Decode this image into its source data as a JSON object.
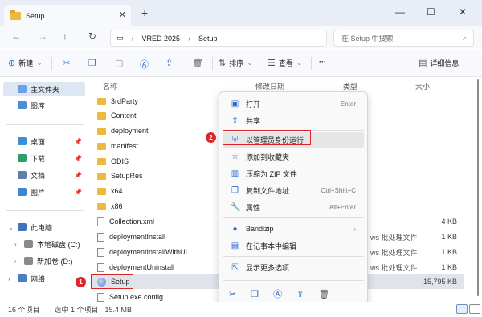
{
  "window": {
    "tab_title": "Setup",
    "close_tab": "✕",
    "new_tab": "+",
    "minimize": "—",
    "maximize": "☐",
    "close": "✕"
  },
  "nav": {
    "back": "←",
    "forward": "→",
    "up": "↑",
    "refresh": "↻"
  },
  "address": {
    "monitor": "▭",
    "sep": "›",
    "crumbs": [
      "VRED 2025",
      "Setup"
    ],
    "chevron": "›",
    "search_placeholder": "在 Setup 中搜索",
    "search_icon": "⌕"
  },
  "toolbar": {
    "new_label": "新建",
    "sort_label": "排序",
    "view_label": "查看",
    "more_label": "···",
    "details_label": "详细信息"
  },
  "sidebar": {
    "home": "主文件夹",
    "gallery": "图库",
    "desktop": "桌面",
    "downloads": "下载",
    "documents": "文档",
    "pictures": "图片",
    "this_pc": "此电脑",
    "local_disk": "本地磁盘 (C:)",
    "new_volume": "新加卷 (D:)",
    "network": "网络"
  },
  "list": {
    "headers": {
      "name": "名称",
      "modified": "修改日期",
      "type": "类型",
      "size": "大小"
    },
    "rows": [
      {
        "name": "3rdParty",
        "kind": "folder",
        "type": "",
        "size": ""
      },
      {
        "name": "Content",
        "kind": "folder",
        "type": "",
        "size": ""
      },
      {
        "name": "deployment",
        "kind": "folder",
        "type": "",
        "size": ""
      },
      {
        "name": "manifest",
        "kind": "folder",
        "type": "",
        "size": ""
      },
      {
        "name": "ODIS",
        "kind": "folder",
        "type": "",
        "size": ""
      },
      {
        "name": "SetupRes",
        "kind": "folder",
        "type": "",
        "size": ""
      },
      {
        "name": "x64",
        "kind": "folder",
        "type": "",
        "size": ""
      },
      {
        "name": "x86",
        "kind": "folder",
        "type": "",
        "size": ""
      },
      {
        "name": "Collection.xml",
        "kind": "xml",
        "type": "",
        "size": "4 KB"
      },
      {
        "name": "deploymentInstall",
        "kind": "bat",
        "type": "ws 批处理文件",
        "size": "1 KB"
      },
      {
        "name": "deploymentInstallWithUI",
        "kind": "bat",
        "type": "ws 批处理文件",
        "size": "1 KB"
      },
      {
        "name": "deploymentUninstall",
        "kind": "bat",
        "type": "ws 批处理文件",
        "size": "1 KB"
      },
      {
        "name": "Setup",
        "kind": "setup",
        "type": "",
        "size": "15,795 KB"
      },
      {
        "name": "Setup.exe.config",
        "kind": "config",
        "type": "",
        "size": ""
      }
    ]
  },
  "context_menu": {
    "open": "打开",
    "open_shortcut": "Enter",
    "share": "共享",
    "run_as_admin": "以管理员身份运行",
    "add_favorites": "添加到收藏夹",
    "compress_zip": "压缩为 ZIP 文件",
    "copy_path": "复制文件地址",
    "copy_path_shortcut": "Ctrl+Shift+C",
    "properties": "属性",
    "properties_shortcut": "Alt+Enter",
    "bandizip": "Bandizip",
    "edit_notepad": "在记事本中编辑",
    "more_options": "显示更多选项"
  },
  "callouts": {
    "one": "1",
    "two": "2"
  },
  "status": {
    "count": "16 个项目",
    "selected": "选中 1 个项目",
    "size": "15.4 MB"
  },
  "colors": {
    "accent": "#2a6bd1",
    "callout": "#d8262a",
    "folder": "#f0b93c"
  }
}
